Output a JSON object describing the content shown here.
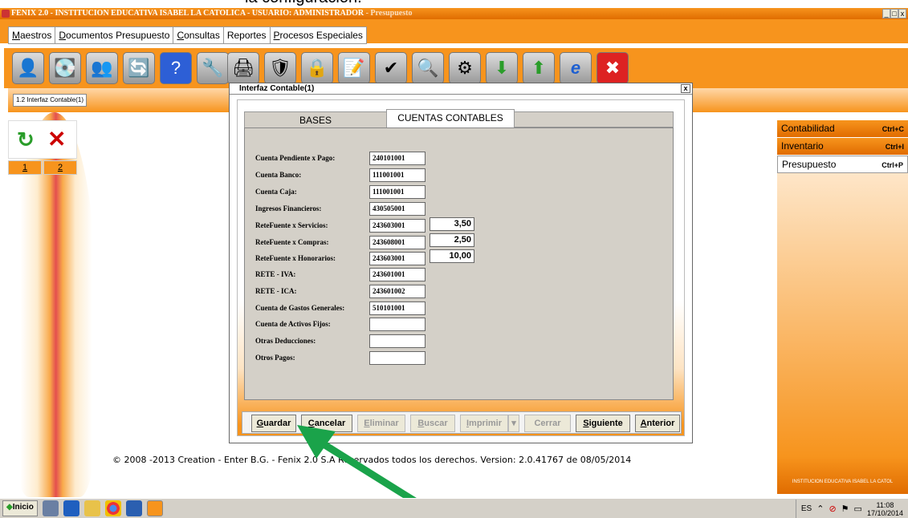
{
  "caption": "la configuración.",
  "window": {
    "title": "FENIX 2.0 - INSTITUCION EDUCATIVA ISABEL LA CATOLICA - USUARIO: ADMINISTRADOR",
    "subtitle": " - Presupuesto",
    "controls": [
      "_",
      "□",
      "x"
    ]
  },
  "menu": [
    {
      "key": "M",
      "rest": "aestros"
    },
    {
      "key": "D",
      "rest": "ocumentos Presupuesto"
    },
    {
      "key": "C",
      "rest": "onsultas"
    },
    {
      "key": "",
      "rest": "Reportes"
    },
    {
      "key": "P",
      "rest": "rocesos Especiales"
    }
  ],
  "toolbar_icons": [
    "user-icon",
    "drive-icon",
    "users-icon",
    "network-icon",
    "help-icon",
    "tools-icon",
    "printer-icon",
    "shield-icon",
    "lock-icon",
    "notepad-icon",
    "checklist-icon",
    "search-doc-icon",
    "admin-icon",
    "download-icon",
    "upload-icon",
    "ie-icon",
    "close-app-icon"
  ],
  "doc_tab": "1.2 Interfaz Contable(1)",
  "left_nav": {
    "n1": "1",
    "n2": "2"
  },
  "dialog": {
    "title": "Interfaz Contable(1)",
    "close": "x",
    "tabs": [
      "BASES",
      "CUENTAS CONTABLES"
    ],
    "fields": [
      {
        "label": "Cuenta Pendiente x Pago:",
        "value": "240101001",
        "pct": ""
      },
      {
        "label": "Cuenta Banco:",
        "value": "111001001",
        "pct": ""
      },
      {
        "label": "Cuenta Caja:",
        "value": "111001001",
        "pct": ""
      },
      {
        "label": "Ingresos Financieros:",
        "value": "430505001",
        "pct": ""
      },
      {
        "label": "ReteFuente x Servicios:",
        "value": "243603001",
        "pct": "3,50"
      },
      {
        "label": "ReteFuente x  Compras:",
        "value": "243608001",
        "pct": "2,50"
      },
      {
        "label": "ReteFuente x  Honorarios:",
        "value": "243603001",
        "pct": "10,00"
      },
      {
        "label": "RETE - IVA:",
        "value": "243601001",
        "pct": ""
      },
      {
        "label": "RETE - ICA:",
        "value": "243601002",
        "pct": ""
      },
      {
        "label": "Cuenta de Gastos Generales:",
        "value": "510101001",
        "pct": ""
      },
      {
        "label": "Cuenta de Activos Fijos:",
        "value": "",
        "pct": ""
      },
      {
        "label": "Otras Deducciones:",
        "value": "",
        "pct": ""
      },
      {
        "label": "Otros Pagos:",
        "value": "",
        "pct": ""
      }
    ],
    "buttons": [
      {
        "key": "G",
        "rest": "uardar",
        "enabled": true
      },
      {
        "key": "C",
        "rest": "ancelar",
        "enabled": true
      },
      {
        "key": "E",
        "rest": "liminar",
        "enabled": false
      },
      {
        "key": "B",
        "rest": "uscar",
        "enabled": false
      },
      {
        "key": "I",
        "rest": "mprimir",
        "enabled": false
      },
      {
        "key": "",
        "rest": "▾",
        "enabled": false
      },
      {
        "key": "",
        "rest": "Cerrar",
        "enabled": false
      },
      {
        "key": "S",
        "rest": "iguiente",
        "enabled": true
      },
      {
        "key": "A",
        "rest": "nterior",
        "enabled": true
      }
    ]
  },
  "footer": "© 2008 -2013 Creation - Enter B.G. - Fenix 2.0 S.A Reservados todos los derechos.   Version: 2.0.41767 de 08/05/2014",
  "right_panel": [
    {
      "label": "Contabilidad",
      "shortcut": "Ctrl+C"
    },
    {
      "label": "Inventario",
      "shortcut": "Ctrl+I"
    },
    {
      "label": "Presupuesto",
      "shortcut": "Ctrl+P"
    }
  ],
  "right_footer": "INSTITUCION EDUCATIVA ISABEL LA CATOL",
  "taskbar": {
    "start": "Inicio",
    "lang": "ES",
    "time": "11:08",
    "date": "17/10/2014"
  },
  "colors": {
    "accent": "#f7941d",
    "arrow": "#1aa34a"
  }
}
